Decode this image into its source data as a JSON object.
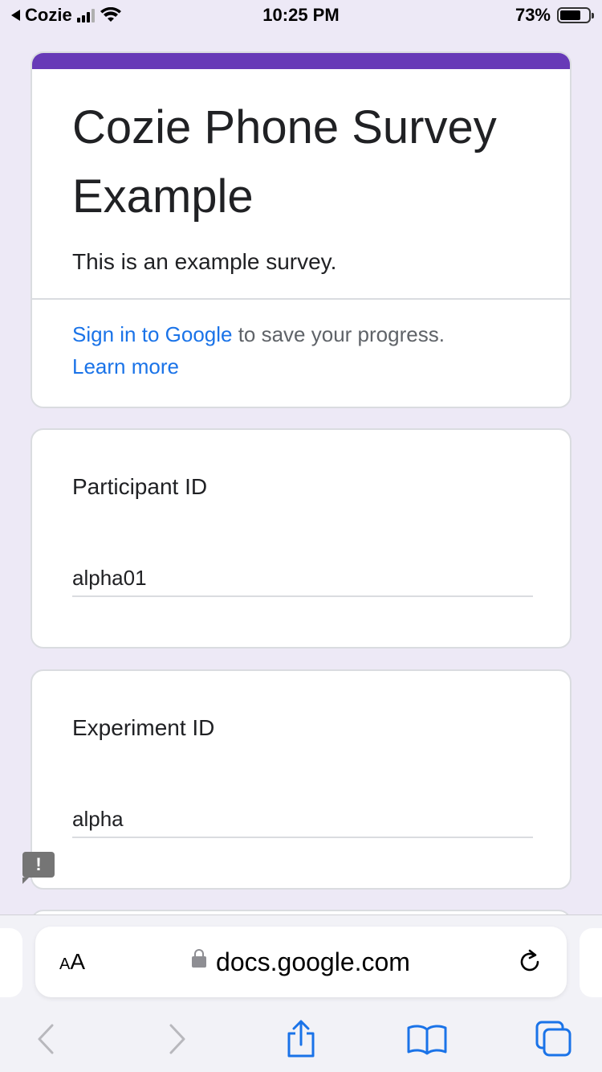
{
  "status_bar": {
    "carrier": "Cozie",
    "time": "10:25 PM",
    "battery": "73%",
    "battery_level": 0.73,
    "back_icon": "back-triangle-icon",
    "signal_icon": "cellular-signal-icon",
    "wifi_icon": "wifi-icon",
    "battery_icon": "battery-icon"
  },
  "form": {
    "accent_color": "#673ab7",
    "title": "Cozie Phone Survey Example",
    "description": "This is an example survey.",
    "signin_link": "Sign in to Google",
    "signin_text": " to save your progress.",
    "learn_more": "Learn more"
  },
  "questions": [
    {
      "label": "Participant ID",
      "value": "alpha01"
    },
    {
      "label": "Experiment ID",
      "value": "alpha"
    }
  ],
  "report": {
    "icon": "report-problem-icon",
    "glyph": "!"
  },
  "browser": {
    "text_size_label_small": "A",
    "text_size_label_large": "A",
    "url": "docs.google.com",
    "lock_icon": "lock-icon",
    "reload_icon": "reload-icon",
    "toolbar": [
      "back-icon",
      "forward-icon",
      "share-icon",
      "bookmarks-icon",
      "tabs-icon"
    ]
  }
}
